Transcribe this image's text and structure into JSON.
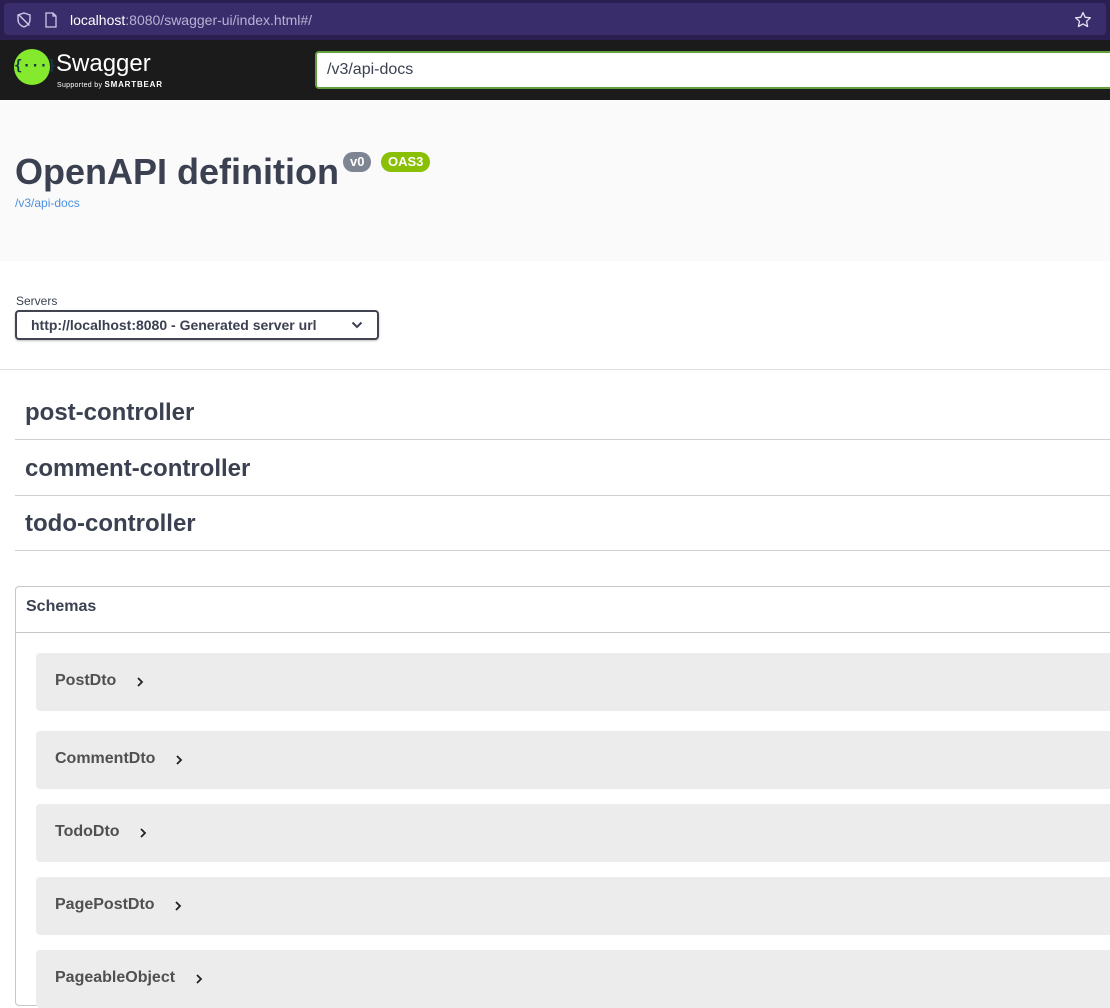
{
  "browser": {
    "url_host": "localhost",
    "url_rest": ":8080/swagger-ui/index.html#/"
  },
  "topbar": {
    "brand": "Swagger",
    "sub_small": "Supported by",
    "sub_bold": "SMARTBEAR",
    "spec_url": "/v3/api-docs"
  },
  "info": {
    "title": "OpenAPI definition",
    "version": "v0",
    "oas": "OAS3",
    "link": "/v3/api-docs"
  },
  "servers": {
    "label": "Servers",
    "selected": "http://localhost:8080 - Generated server url"
  },
  "tags": [
    {
      "name": "post-controller"
    },
    {
      "name": "comment-controller"
    },
    {
      "name": "todo-controller"
    }
  ],
  "schemas": {
    "title": "Schemas",
    "models": [
      {
        "name": "PostDto"
      },
      {
        "name": "CommentDto"
      },
      {
        "name": "TodoDto"
      },
      {
        "name": "PagePostDto"
      },
      {
        "name": "PageableObject"
      }
    ]
  },
  "colors": {
    "topbar": "#1b1b1b",
    "logo_green": "#85ea2d",
    "input_border": "#62a03f",
    "badge_version": "#7d8492",
    "badge_oas": "#89bf04",
    "link": "#4990e2"
  }
}
